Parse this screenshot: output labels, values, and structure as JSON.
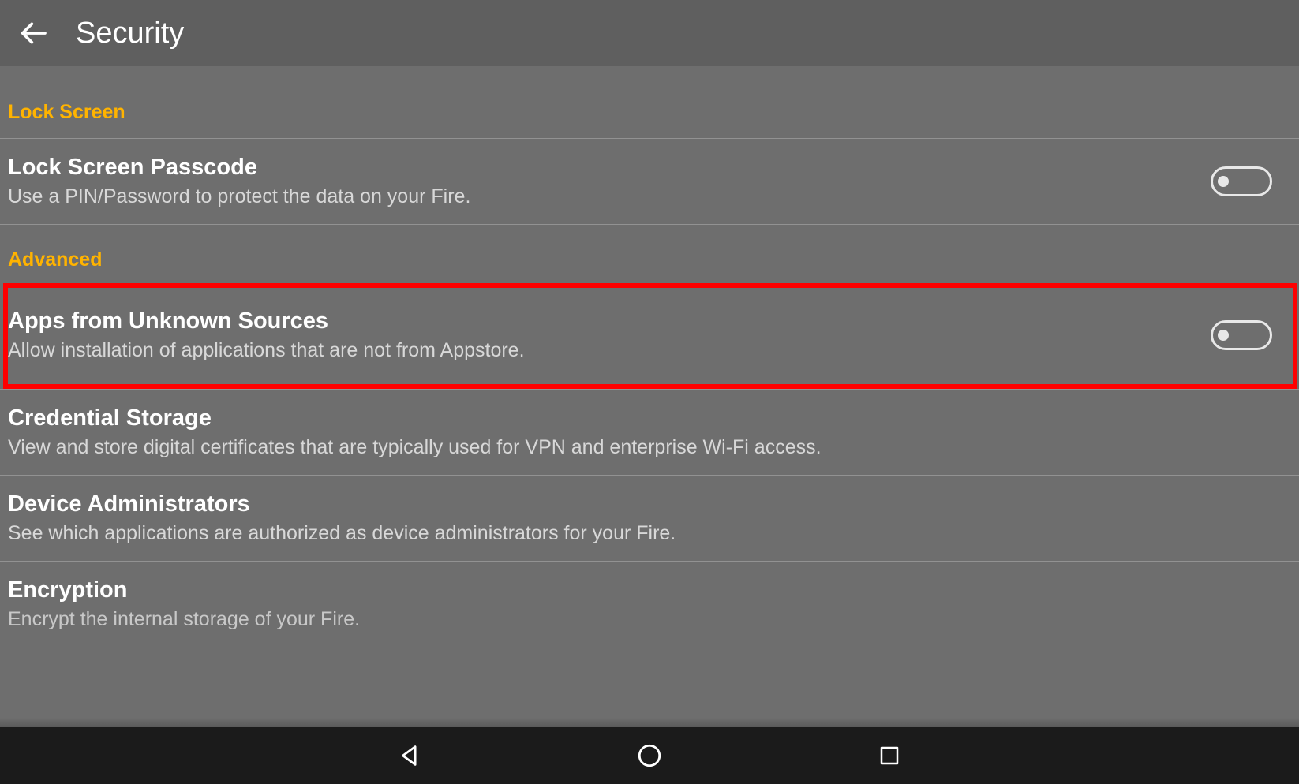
{
  "header": {
    "title": "Security"
  },
  "sections": {
    "lock_screen": {
      "label": "Lock Screen",
      "passcode": {
        "title": "Lock Screen Passcode",
        "sub": "Use a PIN/Password to protect the data on your Fire.",
        "toggle": "off"
      }
    },
    "advanced": {
      "label": "Advanced",
      "unknown_sources": {
        "title": "Apps from Unknown Sources",
        "sub": "Allow installation of applications that are not from Appstore.",
        "toggle": "off",
        "highlighted": true
      },
      "credential_storage": {
        "title": "Credential Storage",
        "sub": "View and store digital certificates that are typically used for VPN and enterprise Wi-Fi access."
      },
      "device_admins": {
        "title": "Device Administrators",
        "sub": "See which applications are authorized as device administrators for your Fire."
      },
      "encryption": {
        "title": "Encryption",
        "sub": "Encrypt the internal storage of your Fire."
      }
    }
  },
  "nav": {
    "back": "back",
    "home": "home",
    "recent": "recent"
  }
}
